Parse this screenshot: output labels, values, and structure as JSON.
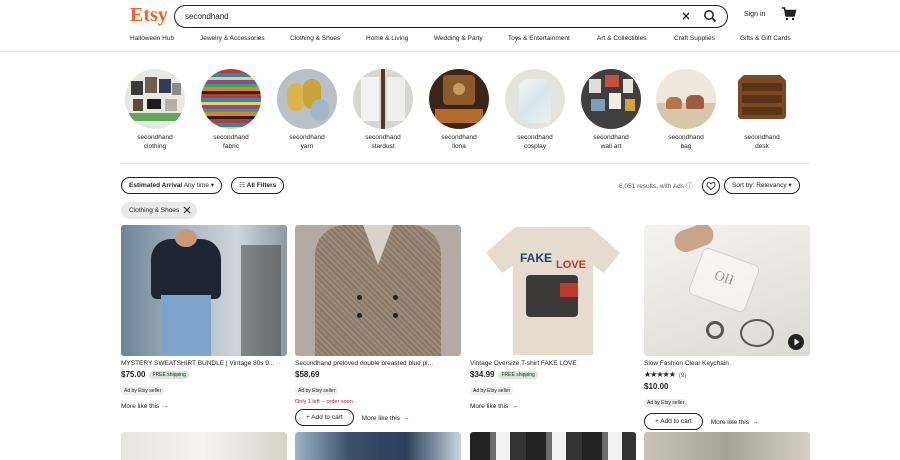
{
  "header": {
    "logo": "Etsy",
    "search_value": "secondhand",
    "signin_label": "Sign in"
  },
  "nav": [
    "Halloween Hub",
    "Jewelry & Accessories",
    "Clothing & Shoes",
    "Home & Living",
    "Wedding & Party",
    "Toys & Entertainment",
    "Art & Collectibles",
    "Craft Supplies",
    "Gifts & Gift Cards"
  ],
  "categories": [
    {
      "line1": "secondhand",
      "line2": "clothing"
    },
    {
      "line1": "secondhand",
      "line2": "fabric"
    },
    {
      "line1": "secondhand",
      "line2": "yarn"
    },
    {
      "line1": "secondhand",
      "line2": "stardust"
    },
    {
      "line1": "secondhand",
      "line2": "llona"
    },
    {
      "line1": "secondhand",
      "line2": "cosplay"
    },
    {
      "line1": "secondhand",
      "line2": "wall art"
    },
    {
      "line1": "secondhand",
      "line2": "bag"
    },
    {
      "line1": "secondhand",
      "line2": "desk"
    }
  ],
  "filters": {
    "arrival_label": "Estimated Arrival",
    "arrival_value": "Any time",
    "all_filters": "All Filters",
    "results": "6,051 results, with Ads",
    "sort_label": "Sort by:",
    "sort_value": "Relevancy",
    "active_chip": "Clothing & Shoes"
  },
  "listings": [
    {
      "title": "MYSTERY SWEATSHIRT BUNDLE | Vintage 80s 9...",
      "price": "$75.00",
      "free": "FREE shipping",
      "ad": "Ad by Etsy seller",
      "more": "More like this"
    },
    {
      "title": "Secondhand preloved double breasted blue pl...",
      "price": "$58.69",
      "ad": "Ad by Etsy seller",
      "warning": "Only 1 left -- order soon",
      "add_to_cart": "+ Add to cart",
      "more": "More like this"
    },
    {
      "title": "Vintage Oversize T-shirt FAKE LOVE",
      "price": "$34.99",
      "free": "FREE shipping",
      "ad": "Ad by Etsy seller",
      "more": "More like this",
      "shirt_text1": "FAKE",
      "shirt_text2": "LOVE"
    },
    {
      "title": "Slow Fashion Clear Keychain",
      "stars": "★★★★★",
      "reviews": "(9)",
      "price": "$10.00",
      "ad": "Ad by Etsy seller",
      "add_to_cart": "+ Add to cart",
      "more": "More like this",
      "keychain_text": "OII"
    }
  ],
  "colors": {
    "brand": "#f1641e",
    "free_bg": "#d4e9d7",
    "warning": "#a61a2e"
  }
}
